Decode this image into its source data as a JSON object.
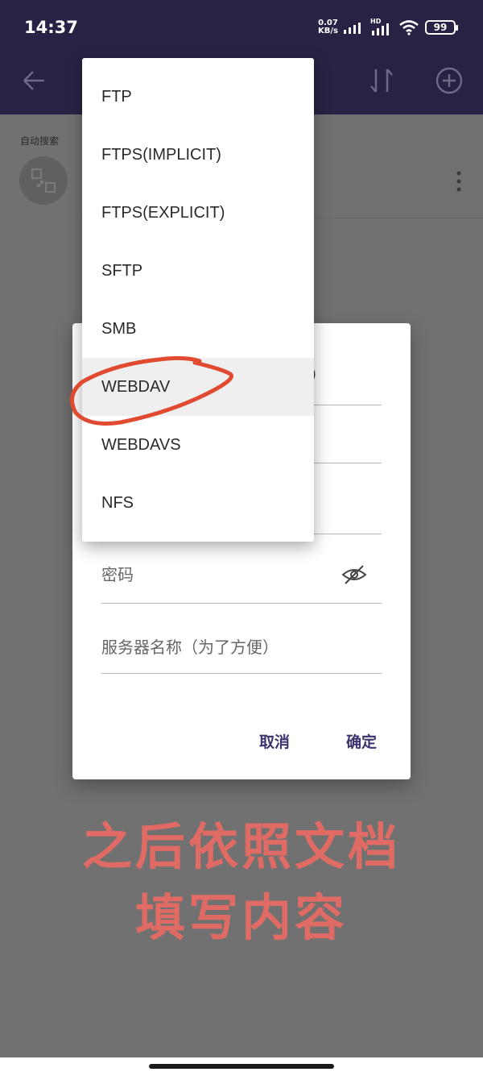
{
  "status_bar": {
    "time": "14:37",
    "net_speed_value": "0.07",
    "net_speed_unit": "KB/s",
    "hd_label": "HD",
    "battery": "99"
  },
  "list": {
    "autosearch_label": "自动搜索"
  },
  "dialog": {
    "fields": {
      "password_label": "密码",
      "server_name_label": "服务器名称（为了方便）"
    },
    "partial_text": "0",
    "cancel_label": "取消",
    "confirm_label": "确定"
  },
  "dropdown": {
    "items": [
      "FTP",
      "FTPS(IMPLICIT)",
      "FTPS(EXPLICIT)",
      "SFTP",
      "SMB",
      "WEBDAV",
      "WEBDAVS",
      "NFS"
    ],
    "selected": "WEBDAV"
  },
  "annotation": {
    "line1": "之后依照文档",
    "line2": "填写内容",
    "color": "#e06a64"
  },
  "colors": {
    "app_bar": "#2a2244",
    "accent_button": "#3d3370",
    "annotation_stroke": "#e04a30"
  },
  "icons": [
    "back-arrow-icon",
    "sort-icon",
    "add-circle-icon",
    "qr-device-icon",
    "more-vertical-icon",
    "eye-off-icon",
    "signal-icon",
    "wifi-icon",
    "battery-icon"
  ]
}
